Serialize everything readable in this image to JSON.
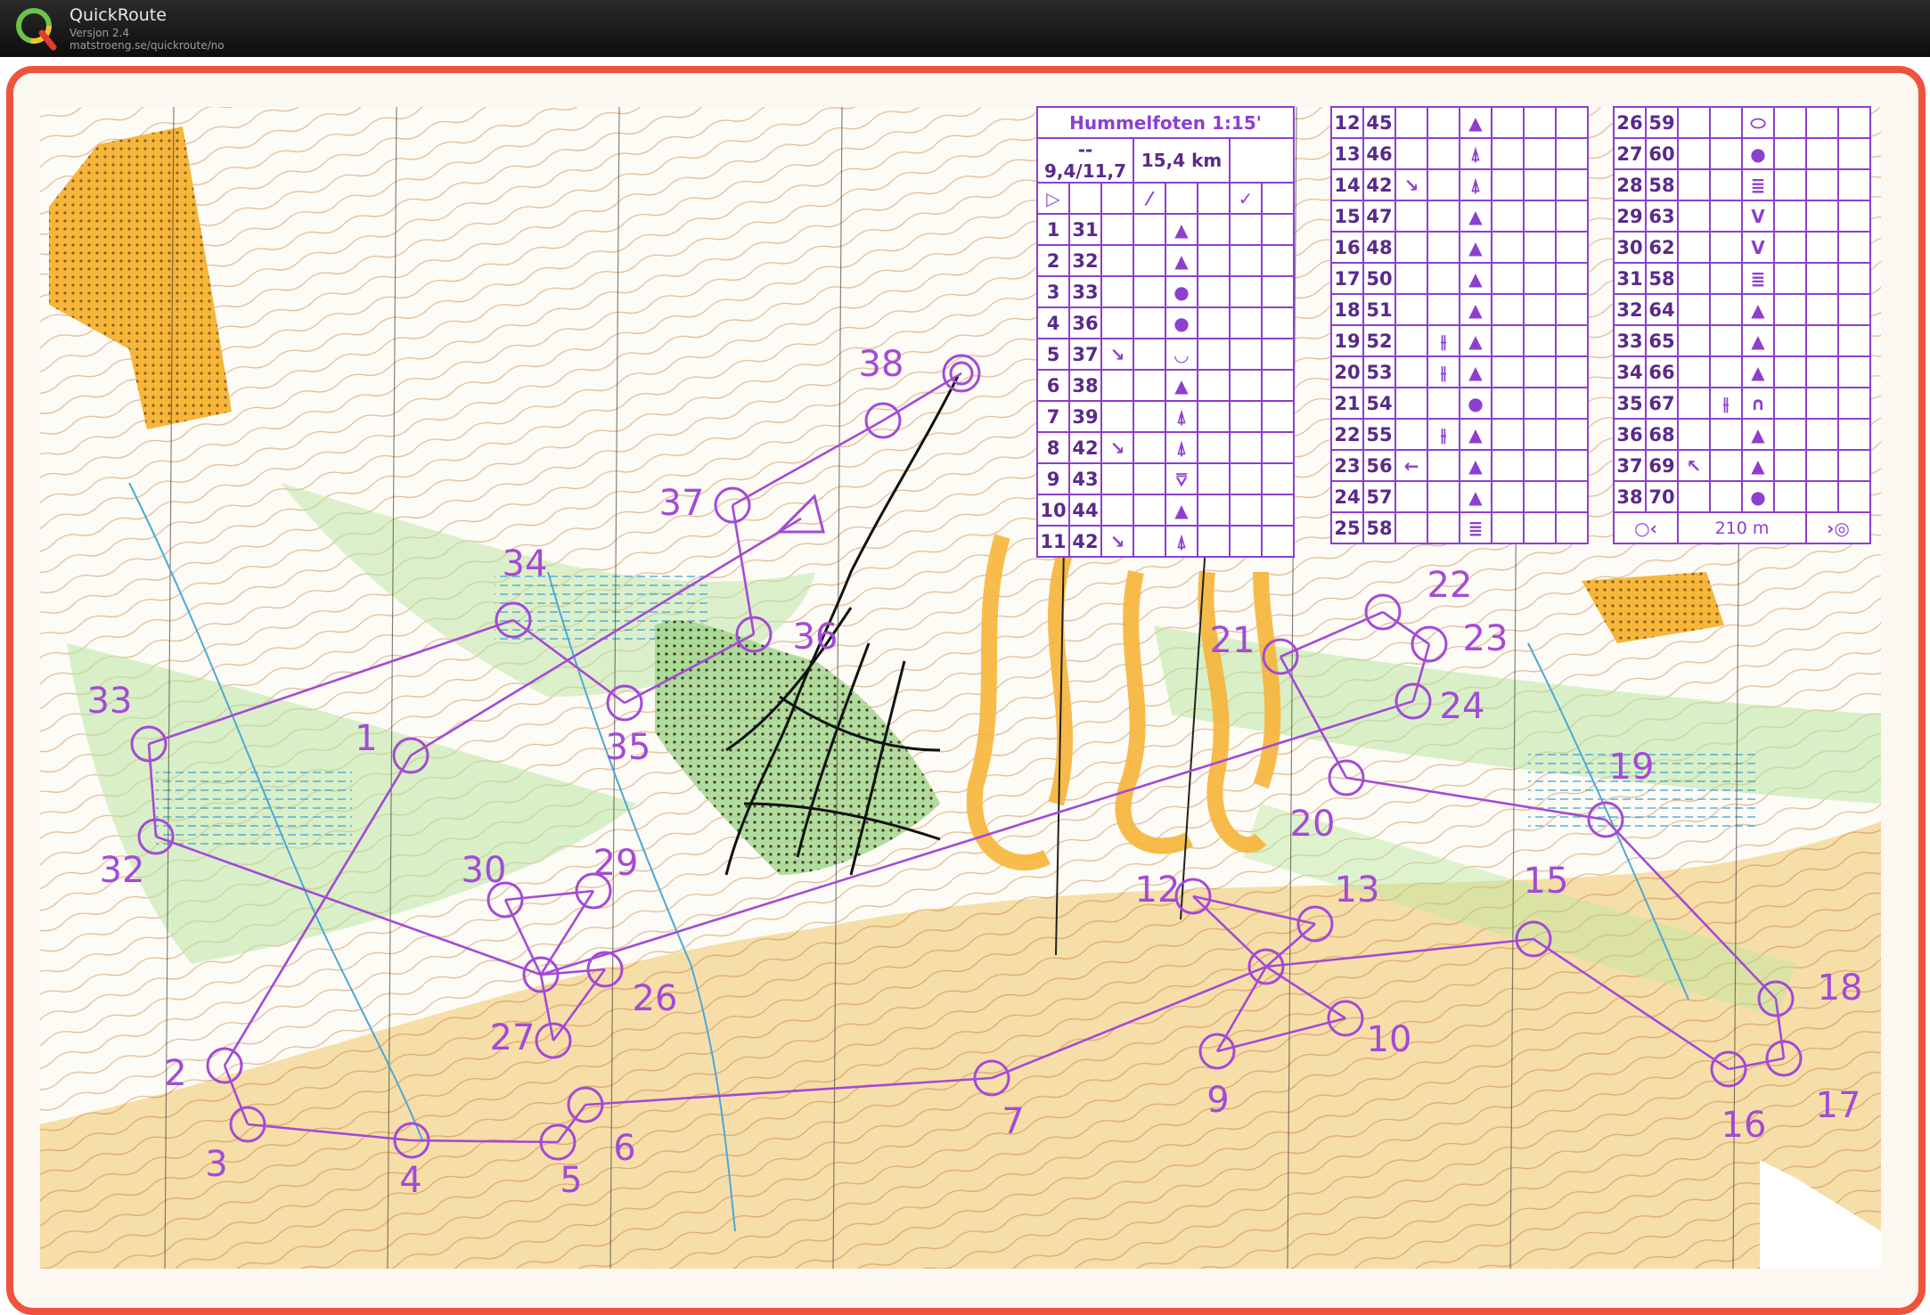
{
  "app": {
    "title": "QuickRoute",
    "version": "Versjon 2.4",
    "url": "matstroeng.se/quickroute/no"
  },
  "colors": {
    "frame": "#f0533c",
    "course": "#a34ad6",
    "route": "#111111",
    "oob_yellow": "#f7b53a",
    "open_land": "#f5d89a",
    "forest_green": "#b9e6a0"
  },
  "course": {
    "name": "Hummelfoten 1:15'",
    "climb": "-- 9,4/11,7",
    "length": "15,4 km",
    "finish_distance": "210 m",
    "controls": [
      {
        "n": "1",
        "code": "31",
        "sym": "▲"
      },
      {
        "n": "2",
        "code": "32",
        "sym": "▲"
      },
      {
        "n": "3",
        "code": "33",
        "sym": "●"
      },
      {
        "n": "4",
        "code": "36",
        "sym": "●"
      },
      {
        "n": "5",
        "code": "37",
        "dir": "↘",
        "sym": "◡"
      },
      {
        "n": "6",
        "code": "38",
        "sym": "▲"
      },
      {
        "n": "7",
        "code": "39",
        "sym": "⍋"
      },
      {
        "n": "8",
        "code": "42",
        "dir": "↘",
        "sym": "⍋"
      },
      {
        "n": "9",
        "code": "43",
        "sym": "⩢"
      },
      {
        "n": "10",
        "code": "44",
        "sym": "▲"
      },
      {
        "n": "11",
        "code": "42",
        "dir": "↘",
        "sym": "⍋"
      },
      {
        "n": "12",
        "code": "45",
        "sym": "▲"
      },
      {
        "n": "13",
        "code": "46",
        "sym": "⍋"
      },
      {
        "n": "14",
        "code": "42",
        "dir": "↘",
        "sym": "⍋"
      },
      {
        "n": "15",
        "code": "47",
        "sym": "▲"
      },
      {
        "n": "16",
        "code": "48",
        "sym": "▲"
      },
      {
        "n": "17",
        "code": "50",
        "sym": "▲"
      },
      {
        "n": "18",
        "code": "51",
        "sym": "▲"
      },
      {
        "n": "19",
        "code": "52",
        "feat": "⫲",
        "sym": "▲"
      },
      {
        "n": "20",
        "code": "53",
        "feat": "⫲",
        "sym": "▲"
      },
      {
        "n": "21",
        "code": "54",
        "sym": "●"
      },
      {
        "n": "22",
        "code": "55",
        "feat": "⫲",
        "sym": "▲"
      },
      {
        "n": "23",
        "code": "56",
        "dir": "←",
        "sym": "▲"
      },
      {
        "n": "24",
        "code": "57",
        "sym": "▲"
      },
      {
        "n": "25",
        "code": "58",
        "sym": "≣"
      },
      {
        "n": "26",
        "code": "59",
        "sym": "⬭"
      },
      {
        "n": "27",
        "code": "60",
        "sym": "●"
      },
      {
        "n": "28",
        "code": "58",
        "sym": "≣"
      },
      {
        "n": "29",
        "code": "63",
        "sym": "V"
      },
      {
        "n": "30",
        "code": "62",
        "sym": "V"
      },
      {
        "n": "31",
        "code": "58",
        "sym": "≣"
      },
      {
        "n": "32",
        "code": "64",
        "sym": "▲"
      },
      {
        "n": "33",
        "code": "65",
        "sym": "▲"
      },
      {
        "n": "34",
        "code": "66",
        "sym": "▲"
      },
      {
        "n": "35",
        "code": "67",
        "feat": "⫲",
        "sym": "∩"
      },
      {
        "n": "36",
        "code": "68",
        "sym": "▲"
      },
      {
        "n": "37",
        "code": "69",
        "dir": "↖",
        "sym": "▲"
      },
      {
        "n": "38",
        "code": "70",
        "sym": "●"
      }
    ]
  },
  "map_labels": [
    "1",
    "2",
    "3",
    "4",
    "5",
    "6",
    "7",
    "9",
    "10",
    "12",
    "13",
    "15",
    "16",
    "17",
    "18",
    "19",
    "20",
    "21",
    "22",
    "23",
    "24",
    "26",
    "27",
    "29",
    "30",
    "32",
    "33",
    "34",
    "35",
    "36",
    "37",
    "38"
  ]
}
